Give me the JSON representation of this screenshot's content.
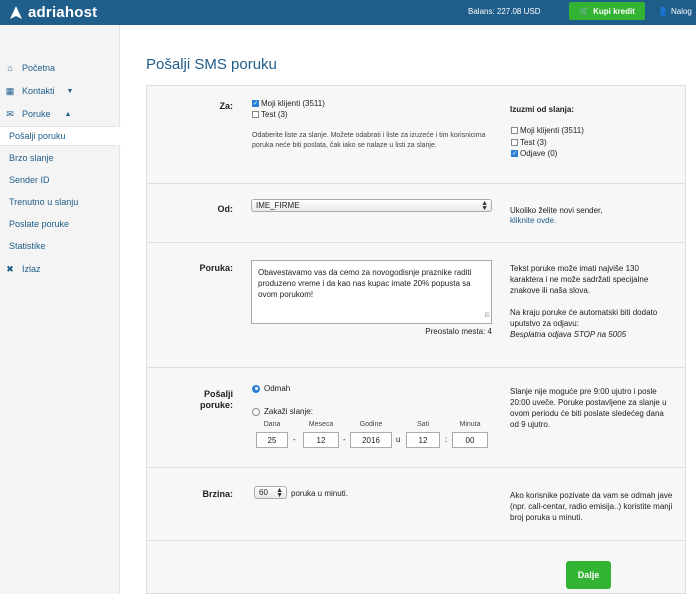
{
  "header": {
    "logo_text": "adriahost",
    "balance_label": "Balans: 227.08 USD",
    "buy_credit_label": "Kupi kredit",
    "account_label": "Nalog"
  },
  "sidebar": {
    "items": [
      {
        "label": "Početna",
        "icon": "home-icon"
      },
      {
        "label": "Kontakti",
        "icon": "book-icon"
      },
      {
        "label": "Poruke",
        "icon": "envelope-icon"
      }
    ],
    "subitems": [
      "Pošalji poruku",
      "Brzo slanje",
      "Sender ID",
      "Trenutno u slanju",
      "Poslate poruke",
      "Statistike"
    ],
    "active_subitem": "Pošalji poruku",
    "logout_label": "Izlaz"
  },
  "page": {
    "title": "Pošalji SMS poruku"
  },
  "form": {
    "za": {
      "label": "Za:",
      "options": [
        {
          "label": "Moji klijenti (3511)",
          "checked": true
        },
        {
          "label": "Test (3)",
          "checked": false
        }
      ],
      "help": "Odaberite liste za slanje. Možete odabrati i liste za izuzeće i tim korisnicima poruka neće biti poslata, čak iako se nalaze u listi za slanje.",
      "exclude_title": "Izuzmi od slanja:",
      "exclude_options": [
        {
          "label": "Moji klijenti (3511)",
          "checked": false
        },
        {
          "label": "Test (3)",
          "checked": false
        },
        {
          "label": "Odjave (0)",
          "checked": true
        }
      ]
    },
    "od": {
      "label": "Od:",
      "selected": "IME_FIRME",
      "help_text": "Ukoliko želite novi sender,",
      "help_link": "kliknite ovde."
    },
    "poruka": {
      "label": "Poruka:",
      "value": "Obavestavamo vas da cemo za novogodisnje praznike raditi produzeno vreme i da kao nas kupac imate 20% popusta sa ovom porukom!",
      "remaining": "Preostalo mesta: 4",
      "help1": "Tekst poruke može imati najviše 130 karaktera i ne može sadržati specijalne znakove ili naša slova.",
      "help2": "Na kraju poruke će automatski biti dodato uputstvo za odjavu:",
      "help3": "Besplatna odjava STOP na 5005"
    },
    "posalji": {
      "label_line1": "Pošalji",
      "label_line2": "poruke:",
      "option_now": "Odmah",
      "option_schedule": "Zakaži slanje:",
      "selected": "Odmah",
      "date_headers": [
        "Dana",
        "Meseca",
        "Godine",
        "Sati",
        "Minuta"
      ],
      "date_values": [
        "25",
        "12",
        "2016",
        "12",
        "00"
      ],
      "separators": [
        "-",
        "-",
        "u",
        ":"
      ],
      "help": "Slanje nije moguće pre 9:00 ujutro i posle 20:00 uveče. Poruke postavljene za slanje u ovom periodu će biti poslate sledećeg dana od 9 ujutro."
    },
    "brzina": {
      "label": "Brzina:",
      "selected": "60",
      "suffix": "poruka u minuti.",
      "help": "Ako korisnike pozivate da vam se odmah jave (npr. call-centar, radio emisija..) koristite manji broj poruka u minuti."
    },
    "submit_label": "Dalje"
  }
}
